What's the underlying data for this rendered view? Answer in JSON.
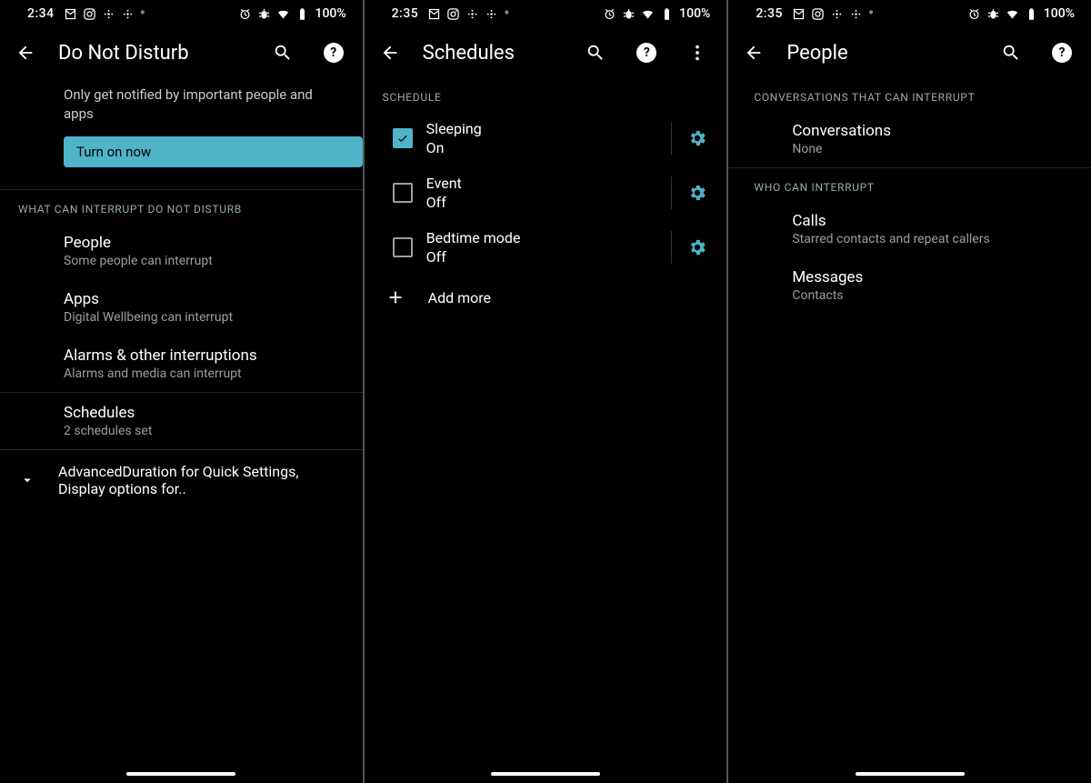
{
  "status_icons": {
    "battery_pct": "100%"
  },
  "screens": [
    {
      "time": "2:34",
      "title": "Do Not Disturb",
      "has_overflow": false,
      "intro": "Only get notified by important people and apps",
      "cta": "Turn on now",
      "section_header": "WHAT CAN INTERRUPT DO NOT DISTURB",
      "items": [
        {
          "primary": "People",
          "secondary": "Some people can interrupt"
        },
        {
          "primary": "Apps",
          "secondary": "Digital Wellbeing can interrupt"
        },
        {
          "primary": "Alarms & other interruptions",
          "secondary": "Alarms and media can interrupt"
        },
        {
          "primary": "Schedules",
          "secondary": "2 schedules set"
        }
      ],
      "advanced": {
        "primary": "Advanced",
        "secondary": "Duration for Quick Settings, Display options for.."
      }
    },
    {
      "time": "2:35",
      "title": "Schedules",
      "has_overflow": true,
      "section_header": "SCHEDULE",
      "schedules": [
        {
          "primary": "Sleeping",
          "secondary": "On",
          "checked": true
        },
        {
          "primary": "Event",
          "secondary": "Off",
          "checked": false
        },
        {
          "primary": "Bedtime mode",
          "secondary": "Off",
          "checked": false
        }
      ],
      "add_more": "Add more"
    },
    {
      "time": "2:35",
      "title": "People",
      "has_overflow": false,
      "sections": [
        {
          "header": "CONVERSATIONS THAT CAN INTERRUPT",
          "items": [
            {
              "primary": "Conversations",
              "secondary": "None"
            }
          ]
        },
        {
          "header": "WHO CAN INTERRUPT",
          "items": [
            {
              "primary": "Calls",
              "secondary": "Starred contacts and repeat callers"
            },
            {
              "primary": "Messages",
              "secondary": "Contacts"
            }
          ]
        }
      ]
    }
  ]
}
